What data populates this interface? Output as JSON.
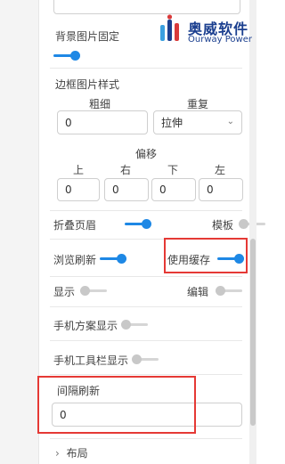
{
  "background_fix": {
    "label": "背景图片固定",
    "enabled": true
  },
  "border_image": {
    "title": "边框图片样式",
    "thickness_label": "粗细",
    "repeat_label": "重复",
    "thickness_value": "0",
    "repeat_value": "拉伸"
  },
  "offset": {
    "title": "偏移",
    "top_label": "上",
    "right_label": "右",
    "bottom_label": "下",
    "left_label": "左",
    "top": "0",
    "right": "0",
    "bottom": "0",
    "left": "0"
  },
  "toggles": {
    "fold_header": {
      "label": "折叠页眉",
      "enabled": true
    },
    "template": {
      "label": "模板",
      "enabled": false
    },
    "browse_refresh": {
      "label": "浏览刷新",
      "enabled": true
    },
    "use_cache": {
      "label": "使用缓存",
      "enabled": true
    },
    "display": {
      "label": "显示",
      "enabled": false
    },
    "edit": {
      "label": "编辑",
      "enabled": false
    },
    "mobile_plan": {
      "label": "手机方案显示",
      "enabled": false
    },
    "mobile_toolbar": {
      "label": "手机工具栏显示",
      "enabled": false
    }
  },
  "interval_refresh": {
    "label": "间隔刷新",
    "value": "0"
  },
  "layout": {
    "label": "布局",
    "chevron": "›"
  },
  "logo": {
    "cn": "奥威软件",
    "en": "Ourway Power"
  },
  "colors": {
    "accent": "#1e88e5",
    "highlight": "#e53935",
    "brand": "#1b3f8f"
  }
}
